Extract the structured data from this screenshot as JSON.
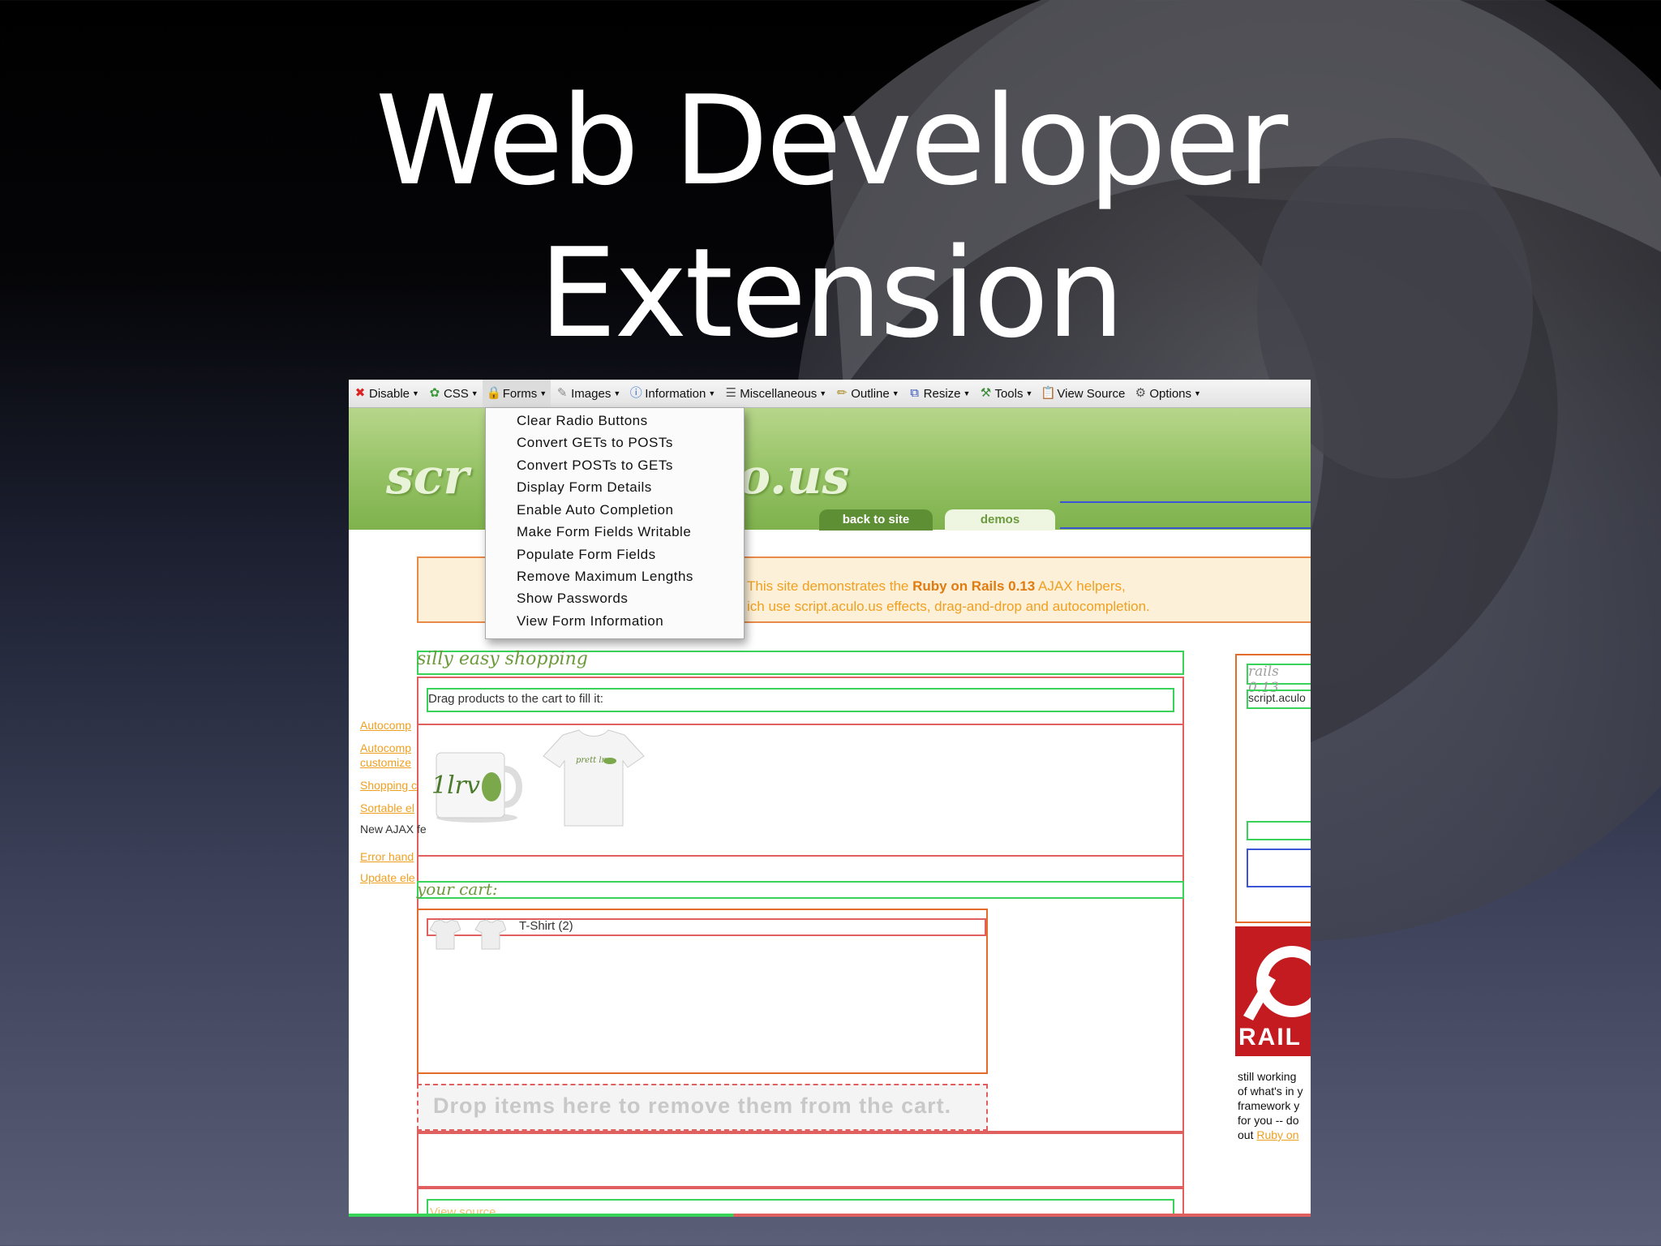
{
  "slide": {
    "title_line1": "Web Developer",
    "title_line2": "Extension"
  },
  "toolbar": {
    "items": [
      {
        "label": "Disable",
        "icon": "disable-icon"
      },
      {
        "label": "CSS",
        "icon": "css-icon"
      },
      {
        "label": "Forms",
        "icon": "forms-icon"
      },
      {
        "label": "Images",
        "icon": "images-icon"
      },
      {
        "label": "Information",
        "icon": "information-icon"
      },
      {
        "label": "Miscellaneous",
        "icon": "miscellaneous-icon"
      },
      {
        "label": "Outline",
        "icon": "outline-icon"
      },
      {
        "label": "Resize",
        "icon": "resize-icon"
      },
      {
        "label": "Tools",
        "icon": "tools-icon"
      },
      {
        "label": "View Source",
        "icon": "view-source-icon"
      },
      {
        "label": "Options",
        "icon": "options-icon"
      }
    ]
  },
  "forms_menu": {
    "items": [
      "Clear Radio Buttons",
      "Convert GETs to POSTs",
      "Convert POSTs to GETs",
      "Display Form Details",
      "Enable Auto Completion",
      "Make Form Fields Writable",
      "Populate Form Fields",
      "Remove Maximum Lengths",
      "Show Passwords",
      "View Form Information"
    ]
  },
  "site": {
    "logo_left": "scr",
    "logo_right": "o.us",
    "tabs": [
      "back to site",
      "demos"
    ],
    "banner_line1_pre": "This site demonstrates the ",
    "banner_line1_bold": "Ruby on Rails 0.13",
    "banner_line1_post": " AJAX helpers,",
    "banner_line2": "ich use script.aculo.us effects, drag-and-drop and autocompletion.",
    "shop_title": "silly easy shopping",
    "drag_hint": "Drag products to the cart to fill it:",
    "cart_title": "your cart:",
    "cart_item": "T-Shirt (2)",
    "drop_text": "Drop items here to remove them from the cart.",
    "view_source": "View source",
    "products": [
      "mug",
      "t-shirt"
    ]
  },
  "sidebar": {
    "heading": "rails 0.13",
    "subheading": "script.aculo",
    "links": [
      "Autocomp",
      "Autocomp",
      "customize",
      "Shopping c",
      "Sortable el",
      "New AJAX fe",
      "Error hand",
      "Update ele"
    ],
    "rails_logo_text": "RAIL",
    "promo_lines": [
      "still working",
      "of what's in y",
      "framework y",
      "for you -- do"
    ],
    "promo_last_pre": "out ",
    "promo_last_link": "Ruby on"
  }
}
